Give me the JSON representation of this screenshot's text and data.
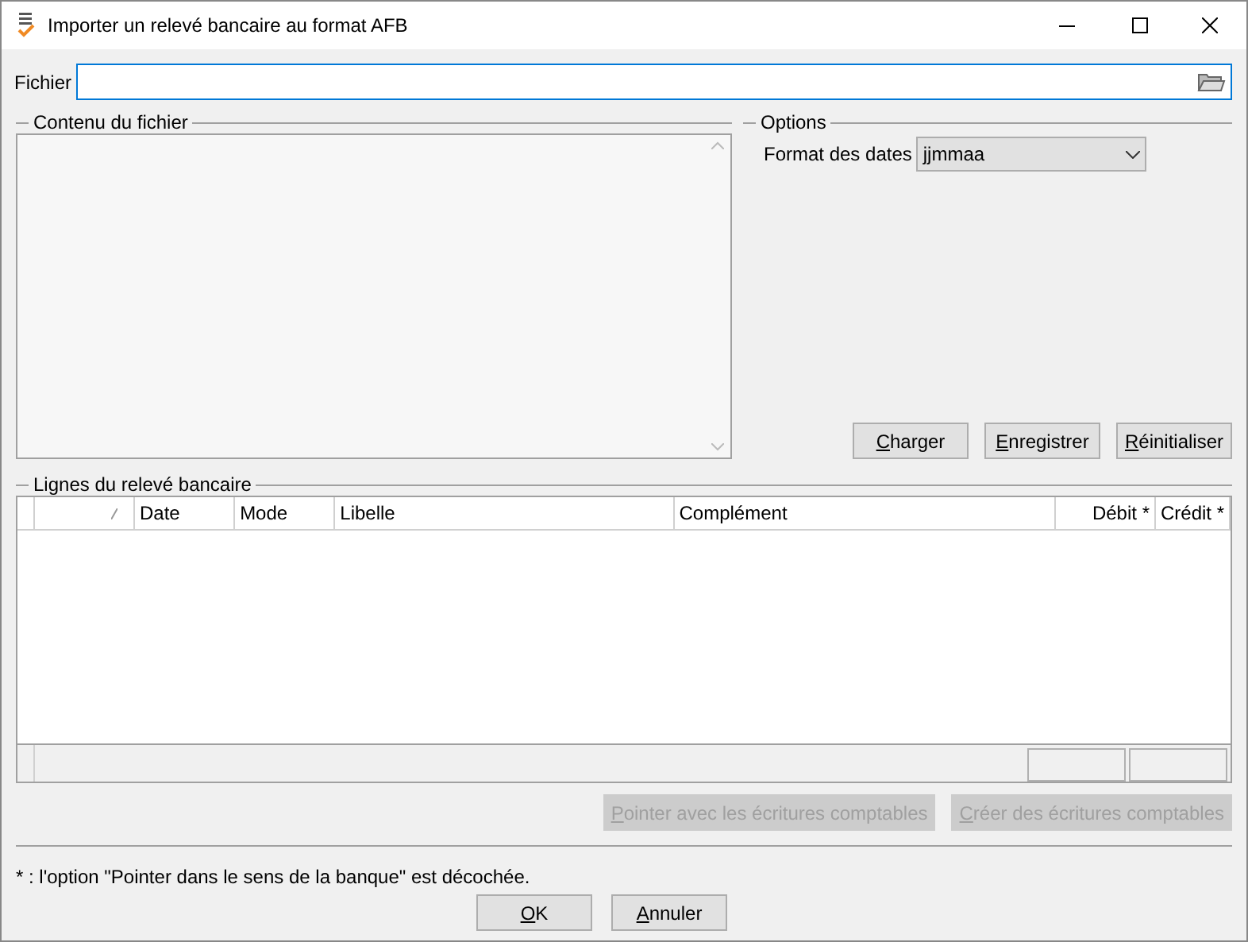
{
  "window": {
    "title": "Importer un relevé bancaire au format AFB"
  },
  "file": {
    "label": "Fichier"
  },
  "content_group": {
    "title": "Contenu du fichier"
  },
  "options": {
    "title": "Options",
    "date_format_label": "Format des dates",
    "date_format_value": "jjmmaa"
  },
  "option_buttons": [
    {
      "label": "Charger",
      "disabled": false
    },
    {
      "label": "Enregistrer",
      "disabled": false
    },
    {
      "label": "Réinitialiser",
      "disabled": false
    }
  ],
  "lines_group": {
    "title": "Lignes du relevé bancaire"
  },
  "table": {
    "columns": [
      "Date",
      "Mode",
      "Libelle",
      "Complément",
      "Débit *",
      "Crédit *"
    ]
  },
  "table_buttons": [
    {
      "label": "Pointer avec les écritures comptables",
      "disabled": true
    },
    {
      "label": "Créer des écritures comptables",
      "disabled": true
    }
  ],
  "footnote": "* : l'option \"Pointer dans le sens de la banque\" est décochée.",
  "dialog_buttons": [
    {
      "label": "OK",
      "disabled": false
    },
    {
      "label": "Annuler",
      "disabled": false
    }
  ]
}
